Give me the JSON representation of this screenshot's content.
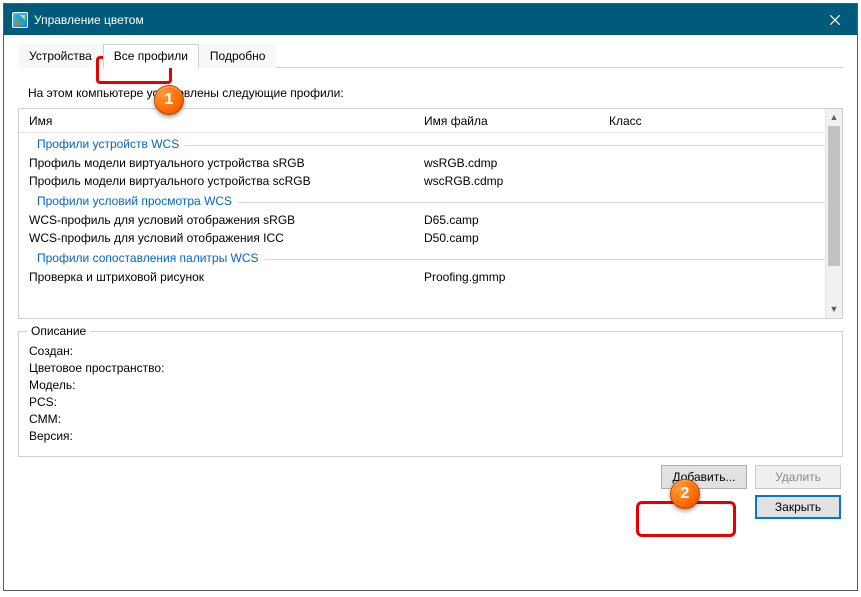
{
  "window": {
    "title": "Управление цветом"
  },
  "tabs": {
    "devices": "Устройства",
    "all_profiles": "Все профили",
    "advanced": "Подробно"
  },
  "instruction": "На этом компьютере установлены следующие профили:",
  "columns": {
    "name": "Имя",
    "file": "Имя файла",
    "class": "Класс"
  },
  "groups": {
    "g1": "Профили устройств WCS",
    "g2": "Профили условий просмотра WCS",
    "g3": "Профили сопоставления палитры WCS"
  },
  "rows": {
    "r1": {
      "name": "Профиль модели виртуального устройства sRGB",
      "file": "wsRGB.cdmp"
    },
    "r2": {
      "name": "Профиль модели виртуального устройства scRGB",
      "file": "wscRGB.cdmp"
    },
    "r3": {
      "name": "WCS-профиль для условий отображения sRGB",
      "file": "D65.camp"
    },
    "r4": {
      "name": "WCS-профиль для условий отображения ICC",
      "file": "D50.camp"
    },
    "r5": {
      "name": "Проверка и штриховой рисунок",
      "file": "Proofing.gmmp"
    }
  },
  "desc": {
    "legend": "Описание",
    "created": "Создан:",
    "colorspace": "Цветовое пространство:",
    "model": "Модель:",
    "pcs": "PCS:",
    "cmm": "CMM:",
    "version": "Версия:"
  },
  "buttons": {
    "add": "Добавить...",
    "remove": "Удалить",
    "close": "Закрыть"
  },
  "annotations": {
    "badge1": "1",
    "badge2": "2"
  }
}
